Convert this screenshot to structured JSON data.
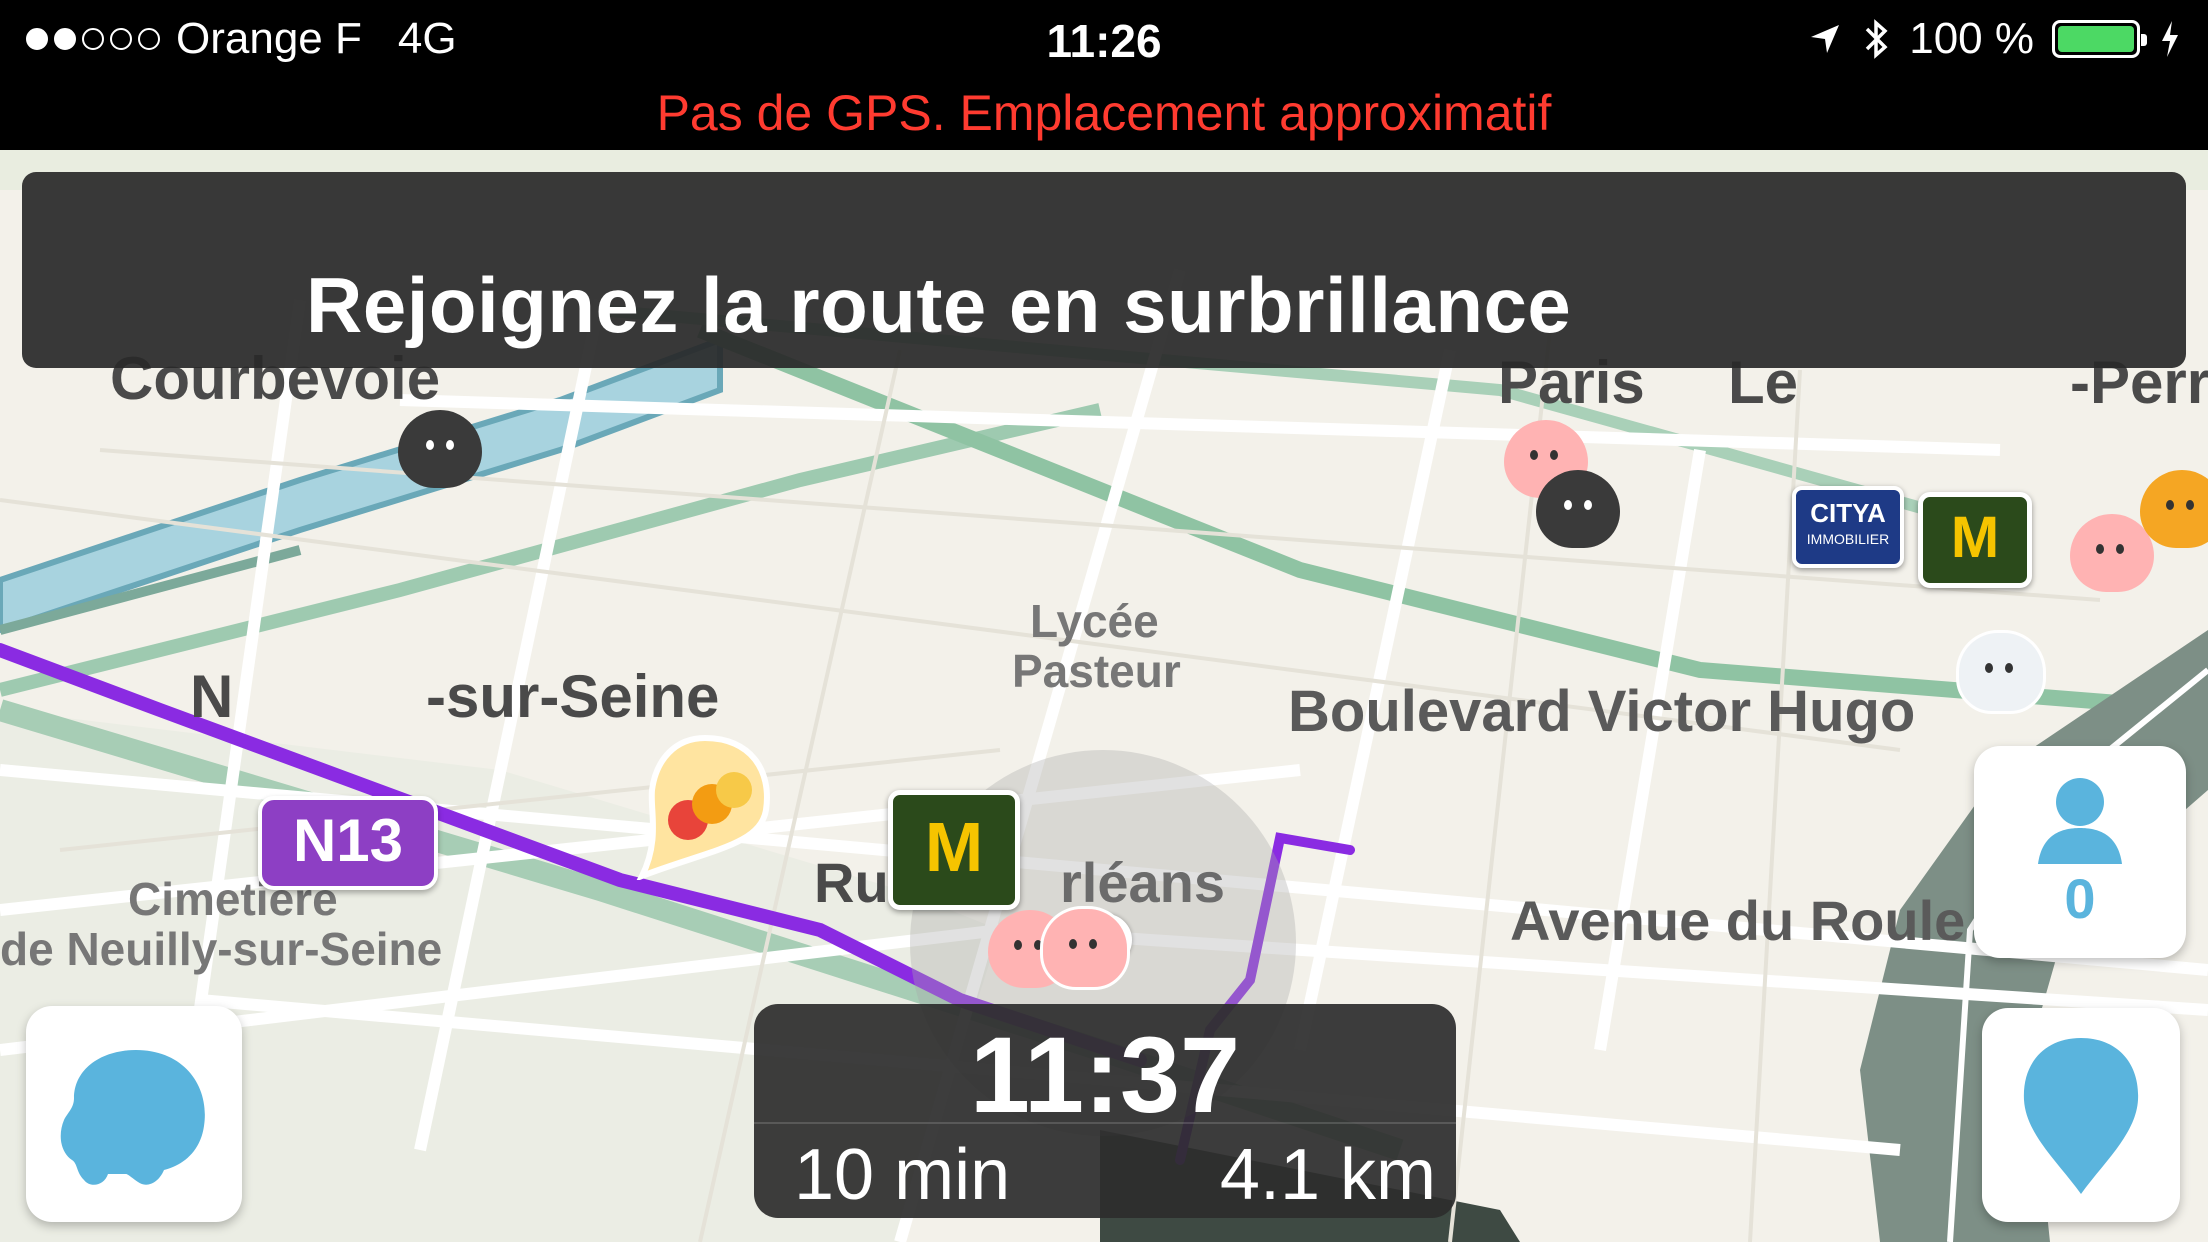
{
  "status_bar": {
    "carrier": "Orange F",
    "network": "4G",
    "time": "11:26",
    "battery_percent": "100 %",
    "battery_level": 1.0,
    "signal_bars_filled": 2,
    "signal_bars_total": 5
  },
  "gps_warning": "Pas de GPS. Emplacement approximatif",
  "instruction_banner": {
    "text": "Rejoignez la route en surbrillance"
  },
  "map": {
    "labels": {
      "courbevoie": "Courbevoie",
      "paris": "Paris",
      "levallois_left": "Le",
      "levallois_right": "-Perr",
      "neuilly_left": "N",
      "neuilly_right": "-sur-Seine",
      "lycee": "Lycée",
      "pasteur": "Pasteur",
      "boulevard": "Boulevard Victor Hugo",
      "rue_orleans_left": "Ru",
      "rue_orleans_right": "rléans",
      "cimetiere_1": "Cimetière",
      "cimetiere_2": "de Neuilly-sur-Seine",
      "avenue_roule": "Avenue du Roule"
    },
    "route_badge": "N13",
    "mcdonalds_symbol": "M",
    "citya_brand": "CITYA",
    "citya_sub": "IMMOBILIER",
    "route_color": "#8a2be2"
  },
  "eta": {
    "arrival_time": "11:37",
    "duration": "10 min",
    "distance": "4.1 km"
  },
  "buttons": {
    "online_users_count": "0"
  },
  "colors": {
    "accent_blue": "#5ab4dd",
    "warning_red": "#ff3b30",
    "route_purple": "#8a2be2"
  }
}
